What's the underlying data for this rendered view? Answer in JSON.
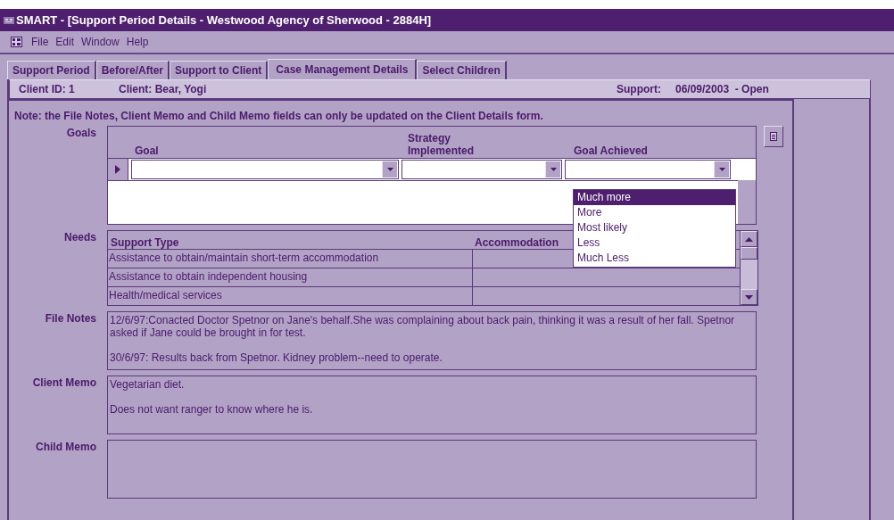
{
  "window": {
    "title": "SMART - [Support Period Details - Westwood Agency of Sherwood - 2884H]"
  },
  "menu": [
    "File",
    "Edit",
    "Window",
    "Help"
  ],
  "tabs": [
    {
      "label": "Support Period",
      "selected": false
    },
    {
      "label": "Before/After",
      "selected": false
    },
    {
      "label": "Support to Client",
      "selected": false
    },
    {
      "label": "Case Management Details",
      "selected": true
    },
    {
      "label": "Select Children",
      "selected": false
    }
  ],
  "client_bar": {
    "client_id": "Client ID: 1",
    "client": "Client: Bear, Yogi",
    "support_label": "Support:",
    "support_value": "06/09/2003  - Open"
  },
  "note": "Note: the File Notes, Client Memo and Child Memo fields can only be updated on the Client Details form.",
  "goals": {
    "label": "Goals",
    "columns": [
      "Goal",
      "Strategy Implemented",
      "Goal Achieved"
    ],
    "dropdown_options": [
      {
        "label": "Much more",
        "selected": true
      },
      {
        "label": "More",
        "selected": false
      },
      {
        "label": "Most likely",
        "selected": false
      },
      {
        "label": "Less",
        "selected": false
      },
      {
        "label": "Much Less",
        "selected": false
      }
    ]
  },
  "needs": {
    "label": "Needs",
    "columns": [
      "Support Type",
      "Accommodation"
    ],
    "rows": [
      {
        "support_type": "Assistance to obtain/maintain short-term accommodation"
      },
      {
        "support_type": "Assistance to obtain independent housing"
      },
      {
        "support_type": "Health/medical services"
      }
    ]
  },
  "memos": [
    {
      "label": "File Notes",
      "value": "12/6/97:Conacted Doctor Spetnor on Jane's behalf.She was complaining about back pain, thinking it was a result of her fall. Spetnor asked if Jane could be brought in for test.\n\n30/6/97: Results back from Spetnor. Kidney problem--need to operate."
    },
    {
      "label": "Client Memo",
      "value": "Vegetarian diet.\n\nDoes not want ranger to know where he is."
    },
    {
      "label": "Child Memo"
    }
  ]
}
